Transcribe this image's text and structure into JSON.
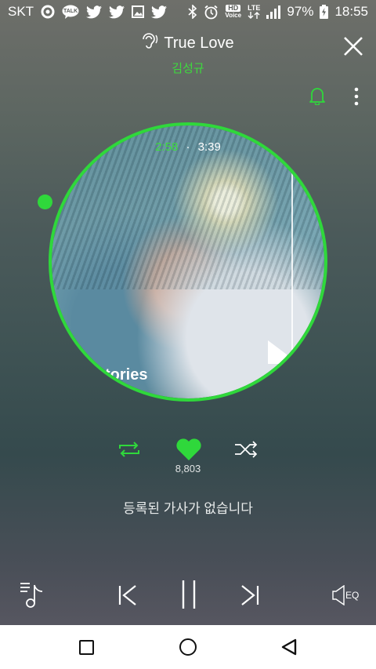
{
  "status_bar": {
    "carrier": "SKT",
    "talk_label": "TALK",
    "hd_label": "HD",
    "voice_label": "Voice",
    "lte_label": "LTE",
    "battery": "97%",
    "time": "18:55",
    "icons": [
      "target-icon",
      "kakaotalk-icon",
      "twitter-icon",
      "twitter-icon",
      "gallery-icon",
      "twitter-icon",
      "bluetooth-icon",
      "alarm-icon",
      "hd-voice-icon",
      "lte-icon",
      "signal-icon",
      "battery-icon"
    ]
  },
  "header": {
    "title": "True Love",
    "artist": "김성규",
    "icons": [
      "listen-icon",
      "close-icon",
      "bell-icon",
      "more-icon"
    ]
  },
  "player": {
    "current_time": "2:58",
    "separator": "·",
    "total_time": "3:39",
    "progress": 0.81,
    "album_text": "tories"
  },
  "actions": {
    "like_count": "8,803",
    "icons": [
      "repeat-icon",
      "heart-icon",
      "shuffle-icon"
    ]
  },
  "lyrics": {
    "message": "등록된 가사가 없습니다"
  },
  "controls": {
    "eq_label": "EQ",
    "icons": [
      "playlist-icon",
      "previous-icon",
      "pause-icon",
      "next-icon",
      "eq-icon"
    ]
  },
  "nav": {
    "icons": [
      "recents-icon",
      "home-icon",
      "back-icon"
    ]
  },
  "colors": {
    "accent": "#2fd83b",
    "accent_text": "#3ddb3d",
    "nav_background": "#ffffff"
  }
}
